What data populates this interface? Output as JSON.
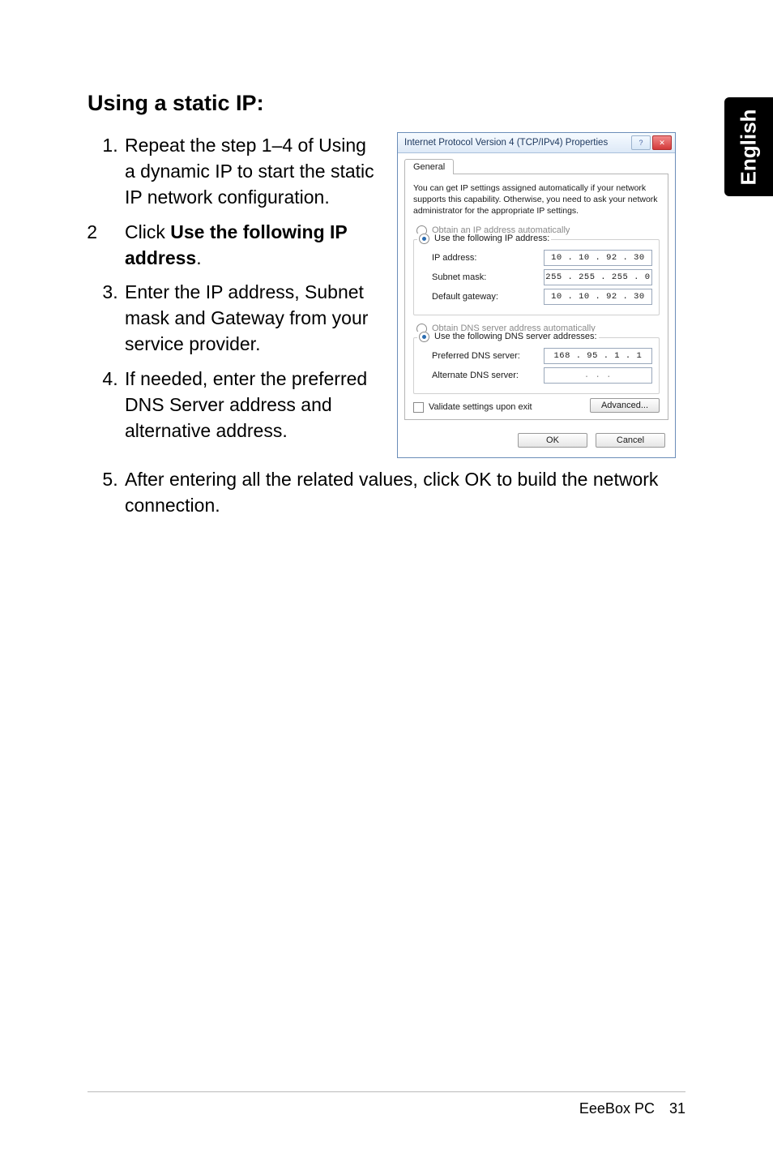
{
  "side_tab": {
    "label": "English"
  },
  "heading": "Using a static IP:",
  "steps": [
    {
      "n": "1.",
      "text": "Repeat the step 1–4 of Using a dynamic IP to start the static IP network configuration."
    },
    {
      "n": "2",
      "pre": "Click ",
      "strong": "Use the following IP address",
      "post": "."
    },
    {
      "n": "3.",
      "text": "Enter the IP address, Subnet mask and Gateway from your service provider."
    },
    {
      "n": "4.",
      "text": "If needed, enter the preferred DNS Server address and alternative address."
    },
    {
      "n": "5.",
      "text": "After entering all the related values, click OK to build the network connection."
    }
  ],
  "dialog": {
    "title": "Internet Protocol Version 4 (TCP/IPv4) Properties",
    "help_icon": "?",
    "close_icon": "✕",
    "tab_general": "General",
    "description": "You can get IP settings assigned automatically if your network supports this capability. Otherwise, you need to ask your network administrator for the appropriate IP settings.",
    "radio_obtain_ip": "Obtain an IP address automatically",
    "radio_use_ip": "Use the following IP address:",
    "label_ip": "IP address:",
    "value_ip": "10 . 10 . 92 . 30",
    "label_subnet": "Subnet mask:",
    "value_subnet": "255 . 255 . 255 . 0",
    "label_gateway": "Default gateway:",
    "value_gateway": "10 . 10 . 92 . 30",
    "radio_obtain_dns": "Obtain DNS server address automatically",
    "radio_use_dns": "Use the following DNS server addresses:",
    "label_pref_dns": "Preferred DNS server:",
    "value_pref_dns": "168 . 95 . 1 . 1",
    "label_alt_dns": "Alternate DNS server:",
    "value_alt_dns": ".     .     .",
    "validate_label": "Validate settings upon exit",
    "btn_advanced": "Advanced...",
    "btn_ok": "OK",
    "btn_cancel": "Cancel"
  },
  "footer": {
    "product": "EeeBox PC",
    "page": "31"
  }
}
